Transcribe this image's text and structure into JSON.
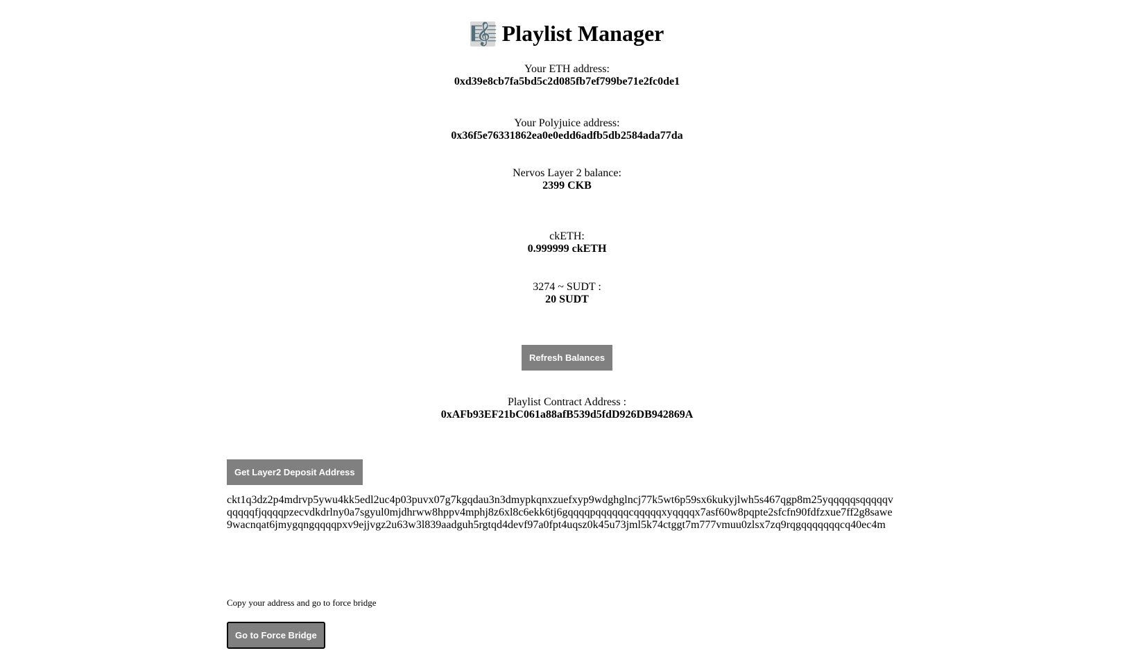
{
  "header": {
    "icon": "music-staff-icon",
    "icon_glyph": "🎼",
    "title": "Playlist Manager"
  },
  "eth": {
    "label": "Your ETH address:",
    "value": "0xd39e8cb7fa5bd5c2d085fb7ef799be71e2fc0de1"
  },
  "polyjuice": {
    "label": "Your Polyjuice address:",
    "value": "0x36f5e76331862ea0e0edd6adfb5db2584ada77da"
  },
  "layer2_balance": {
    "label": "Nervos Layer 2 balance:",
    "value": "2399 CKB"
  },
  "cketh": {
    "label": "ckETH:",
    "value": "0.999999 ckETH"
  },
  "sudt": {
    "label": "3274 ~ SUDT :",
    "value": "20 SUDT"
  },
  "refresh_button": "Refresh Balances",
  "contract": {
    "label": "Playlist Contract Address :",
    "value": "0xAFb93EF21bC061a88afB539d5fdD926DB942869A"
  },
  "deposit_button": "Get Layer2 Deposit Address",
  "deposit_address": "ckt1q3dz2p4mdrvp5ywu4kk5edl2uc4p03puvx07g7kgqdau3n3dmypkqnxzuefxyp9wdghglncj77k5wt6p59sx6kukyjlwh5s467qgp8m25yqqqqqsqqqqqvqqqqqfjqqqqpzecvdkdrlny0a7sgyul0mjdhrww8hppv4mphj8z6xl8c6ekk6tj6gqqqqpqqqqqqcqqqqqxyqqqqx7asf60w8pqpte2sfcfn90fdfzxue7ff2g8sawe9wacnqat6jmygqngqqqqpxv9ejjvgz2u63w3l839aadguh5rgtqd4devf97a0fpt4uqsz0k45u73jml5k74ctggt7m777vmuu0zlsx7zq9rqgqqqqqqqcq40ec4m",
  "force_bridge": {
    "note": "Copy your address and go to force bridge",
    "button": "Go to Force Bridge"
  }
}
